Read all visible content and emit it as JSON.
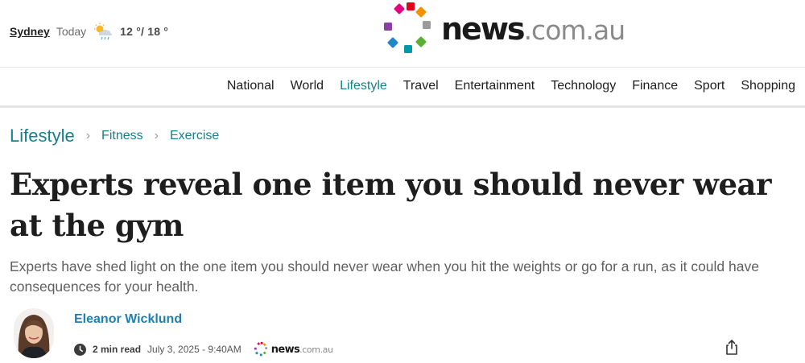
{
  "weather": {
    "city": "Sydney",
    "day": "Today",
    "icon": "partly-cloudy-rain-icon",
    "temp": "12 °/ 18 °"
  },
  "logo": {
    "word_news": "news",
    "word_domain": ".com.au",
    "dot_colors": [
      "#e6007e",
      "#e2001a",
      "#f39200",
      "#9b9b9b",
      "#5ab031",
      "#009aa6",
      "#1e88c7",
      "#8b3fa3"
    ]
  },
  "nav": {
    "items": [
      "National",
      "World",
      "Lifestyle",
      "Travel",
      "Entertainment",
      "Technology",
      "Finance",
      "Sport",
      "Shopping"
    ],
    "active": "Lifestyle"
  },
  "breadcrumb": {
    "section": "Lifestyle",
    "sub1": "Fitness",
    "sub2": "Exercise"
  },
  "article": {
    "headline": "Experts reveal one item you should never wear at the gym",
    "standfirst": "Experts have shed light on the one item you should never wear when you hit the weights or go for a run, as it could have consequences for your health.",
    "author": "Eleanor Wicklund",
    "read_time": "2 min read",
    "date": "July 3, 2025 - 9:40AM",
    "source_news": "news",
    "source_domain": ".com.au"
  },
  "colors": {
    "accent": "#16818c",
    "author": "#1c7fb6"
  }
}
